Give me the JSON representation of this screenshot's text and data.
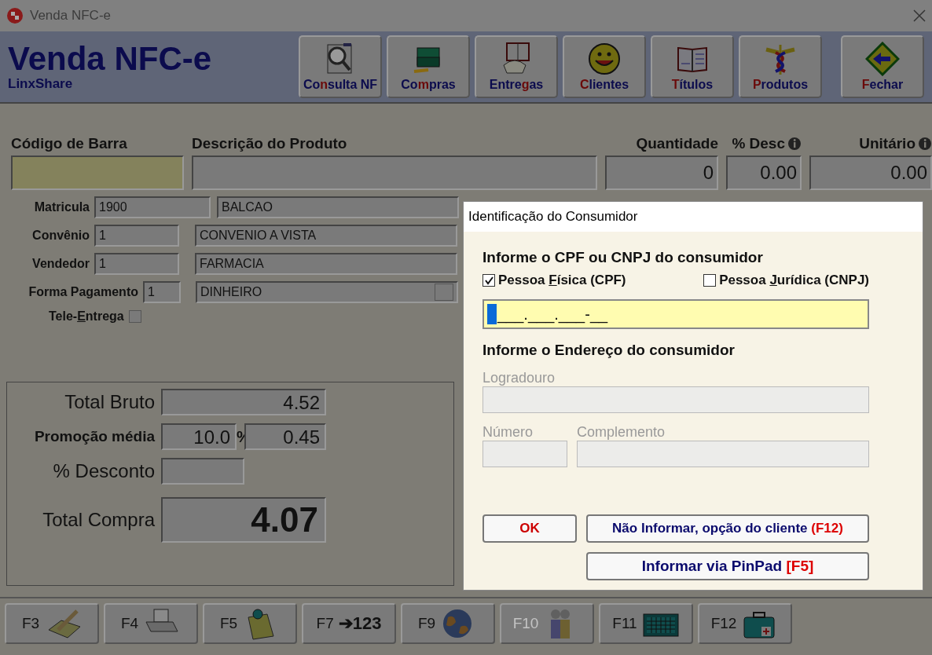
{
  "window": {
    "title": "Venda NFC-e"
  },
  "header": {
    "title": "Venda NFC-e",
    "subtitle": "LinxShare"
  },
  "toolbar": [
    {
      "kind": "search",
      "before": "Co",
      "key": "n",
      "after": "sulta NF"
    },
    {
      "kind": "box",
      "before": "Co",
      "key": "m",
      "after": "pras"
    },
    {
      "kind": "phone",
      "before": "Entre",
      "key": "g",
      "after": "as"
    },
    {
      "kind": "smiley",
      "key": "C",
      "after": "lientes"
    },
    {
      "kind": "book",
      "key": "T",
      "after": "ítulos"
    },
    {
      "kind": "caduceus",
      "key": "P",
      "after": "rodutos"
    },
    {
      "kind": "exit",
      "key": "F",
      "after": "echar"
    }
  ],
  "product": {
    "columns": [
      {
        "label": "Código de Barra",
        "info": false,
        "kind": "barcode"
      },
      {
        "label": "Descrição do Produto",
        "info": false,
        "kind": "desc"
      },
      {
        "label": "Quantidade",
        "value": "0",
        "info": false,
        "kind": "qty"
      },
      {
        "label": "% Desc",
        "value": "0.00",
        "info": true,
        "kind": "disc"
      },
      {
        "label": "Unitário",
        "value": "0.00",
        "info": true,
        "kind": "unit"
      }
    ]
  },
  "fields": [
    {
      "label": "Matricula",
      "code": "1900",
      "name": "BALCAO",
      "kind": "wide",
      "dropdown": false
    },
    {
      "label": "Convênio",
      "code": "1",
      "name": "CONVENIO A VISTA",
      "kind": "normal",
      "dropdown": false
    },
    {
      "label": "Vendedor",
      "code": "1",
      "name": "FARMACIA",
      "kind": "normal",
      "dropdown": false
    },
    {
      "label": "Forma Pagamento",
      "code": "1",
      "name": "DINHEIRO",
      "kind": "short",
      "dropdown": true
    }
  ],
  "tele_entrega": {
    "before": "Tele-",
    "key": "E",
    "after": "ntrega",
    "checked": false
  },
  "totals": {
    "total_bruto": {
      "label": "Total Bruto",
      "value": "4.52"
    },
    "promocao": {
      "label": "Promoção média",
      "percent": "10.0",
      "percent_sign": "%",
      "value": "0.45"
    },
    "desconto": {
      "label": "% Desconto"
    },
    "total_compra": {
      "label": "Total Compra",
      "value": "4.07"
    }
  },
  "fkeys": [
    {
      "label": "F3",
      "kind": "pen",
      "disabled": false
    },
    {
      "label": "F4",
      "kind": "printer",
      "disabled": false
    },
    {
      "label": "F5",
      "kind": "note",
      "disabled": false
    },
    {
      "label": "F7",
      "kind": "numbers",
      "text": "➔123",
      "disabled": false
    },
    {
      "label": "F9",
      "kind": "globe",
      "disabled": false
    },
    {
      "label": "F10",
      "kind": "people",
      "disabled": true
    },
    {
      "label": "F11",
      "kind": "keypad",
      "disabled": false
    },
    {
      "label": "F12",
      "kind": "medkit",
      "disabled": false
    }
  ],
  "dialog": {
    "title": "Identificação do Consumidor",
    "cpf_heading": "Informe o CPF ou CNPJ do consumidor",
    "options": [
      {
        "before": "Pessoa ",
        "key": "F",
        "after": "ísica (CPF)",
        "checked": true
      },
      {
        "before": "Pessoa ",
        "key": "J",
        "after": "urídica (CNPJ)",
        "checked": false
      }
    ],
    "cpf_field": {
      "value": "___.___.___-__"
    },
    "address_heading": "Informe o Endereço do consumidor",
    "logradouro": {
      "label": "Logradouro",
      "disabled": true
    },
    "numero": {
      "label": "Número",
      "disabled": true
    },
    "complemento": {
      "label": "Complemento",
      "disabled": true
    },
    "buttons": [
      {
        "kind": "ok",
        "text": "OK"
      },
      {
        "kind": "skip",
        "text": "Não Informar, opção do cliente",
        "hotkey": "(F12)"
      },
      {
        "kind": "pinpad",
        "text": "Informar via PinPad",
        "hotkey": "[F5]"
      }
    ]
  }
}
